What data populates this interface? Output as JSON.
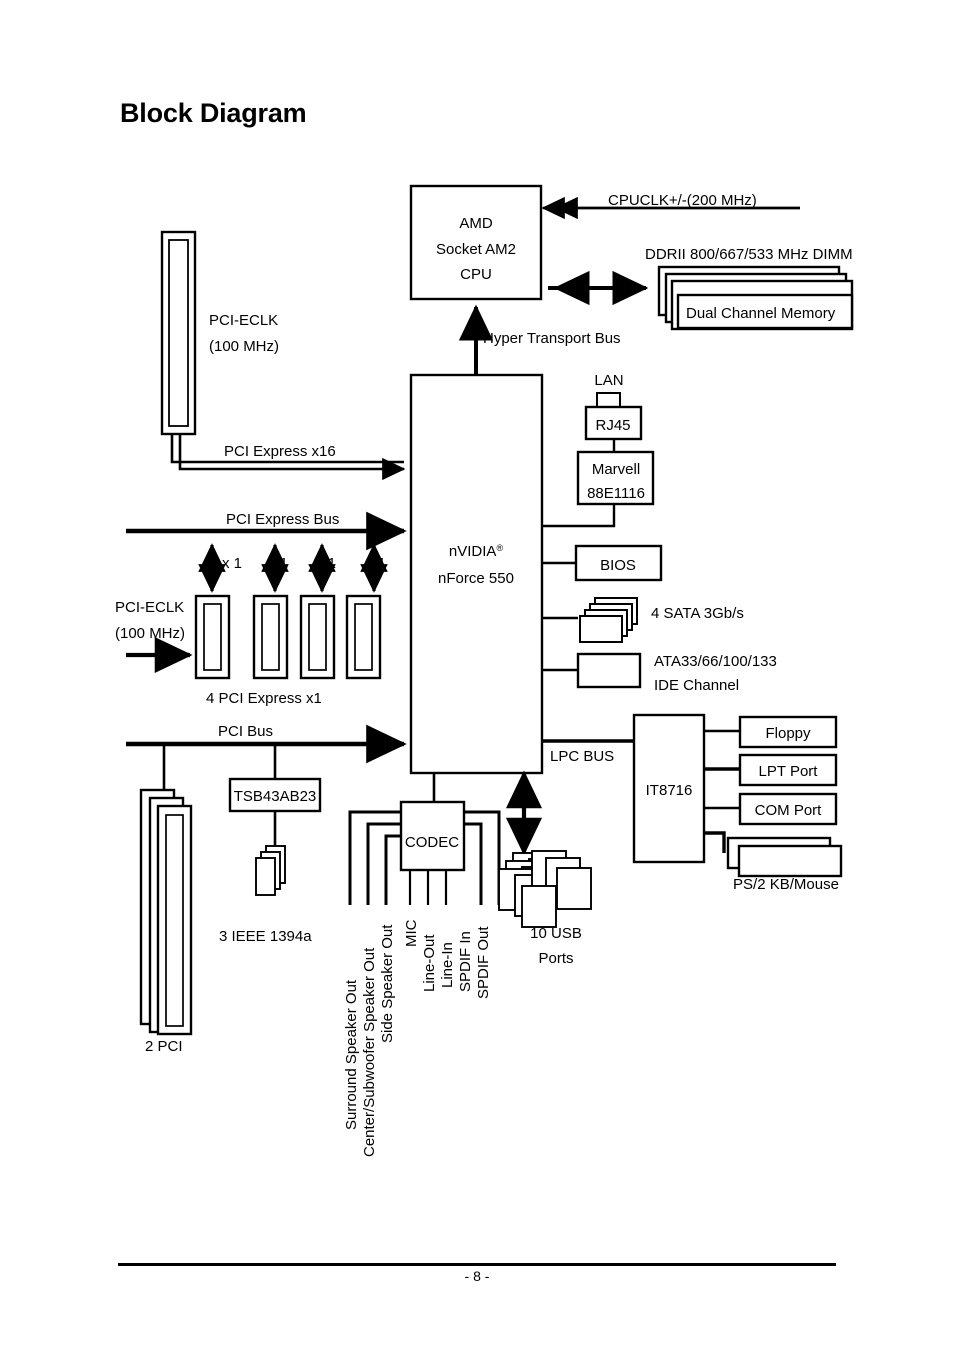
{
  "page": {
    "title": "Block Diagram",
    "footer_page_number": "- 8 -"
  },
  "blocks": {
    "cpu": {
      "line1": "AMD",
      "line2": "Socket AM2",
      "line3": "CPU"
    },
    "northbridge": {
      "line1": "nVIDIA",
      "superscript": "®",
      "line2": "nForce 550"
    },
    "memory": {
      "label": "Dual Channel Memory",
      "header": "DDRII 800/667/533 MHz DIMM"
    },
    "rj45": "RJ45",
    "lan": "LAN",
    "marvell": {
      "line1": "Marvell",
      "line2": "88E1116"
    },
    "bios": "BIOS",
    "codec": "CODEC",
    "superio": "IT8716",
    "firewire_chip": "TSB43AB23",
    "floppy": "Floppy",
    "lpt": "LPT Port",
    "com": "COM Port"
  },
  "buses": {
    "cpuclk": "CPUCLK+/-(200 MHz)",
    "hyper_transport": "Hyper Transport Bus",
    "pcie_x16": "PCI Express x16",
    "pcie_bus": "PCI Express Bus",
    "pci_bus": "PCI Bus",
    "lpc_bus": "LPC BUS",
    "lane_x1": "x 1"
  },
  "clocks": {
    "top": {
      "line1": "PCI-ECLK",
      "line2": "(100 MHz)"
    },
    "bottom": {
      "line1": "PCI-ECLK",
      "line2": "(100 MHz)"
    }
  },
  "slots": {
    "pcie_x1_label": "4 PCI Express x1",
    "pci_label": "2 PCI"
  },
  "storage": {
    "sata": "4 SATA 3Gb/s",
    "ide_line1": "ATA33/66/100/133",
    "ide_line2": "IDE Channel"
  },
  "peripherals": {
    "usb_line1": "10 USB",
    "usb_line2": "Ports",
    "ps2": "PS/2 KB/Mouse",
    "ieee1394": "3 IEEE 1394a"
  },
  "audio_ports": [
    "Surround Speaker Out",
    "Center/Subwoofer Speaker Out",
    "Side Speaker Out",
    "MIC",
    "Line-Out",
    "Line-In",
    "SPDIF In",
    "SPDIF Out"
  ],
  "colors": {
    "ink": "#000000",
    "paper": "#ffffff"
  }
}
